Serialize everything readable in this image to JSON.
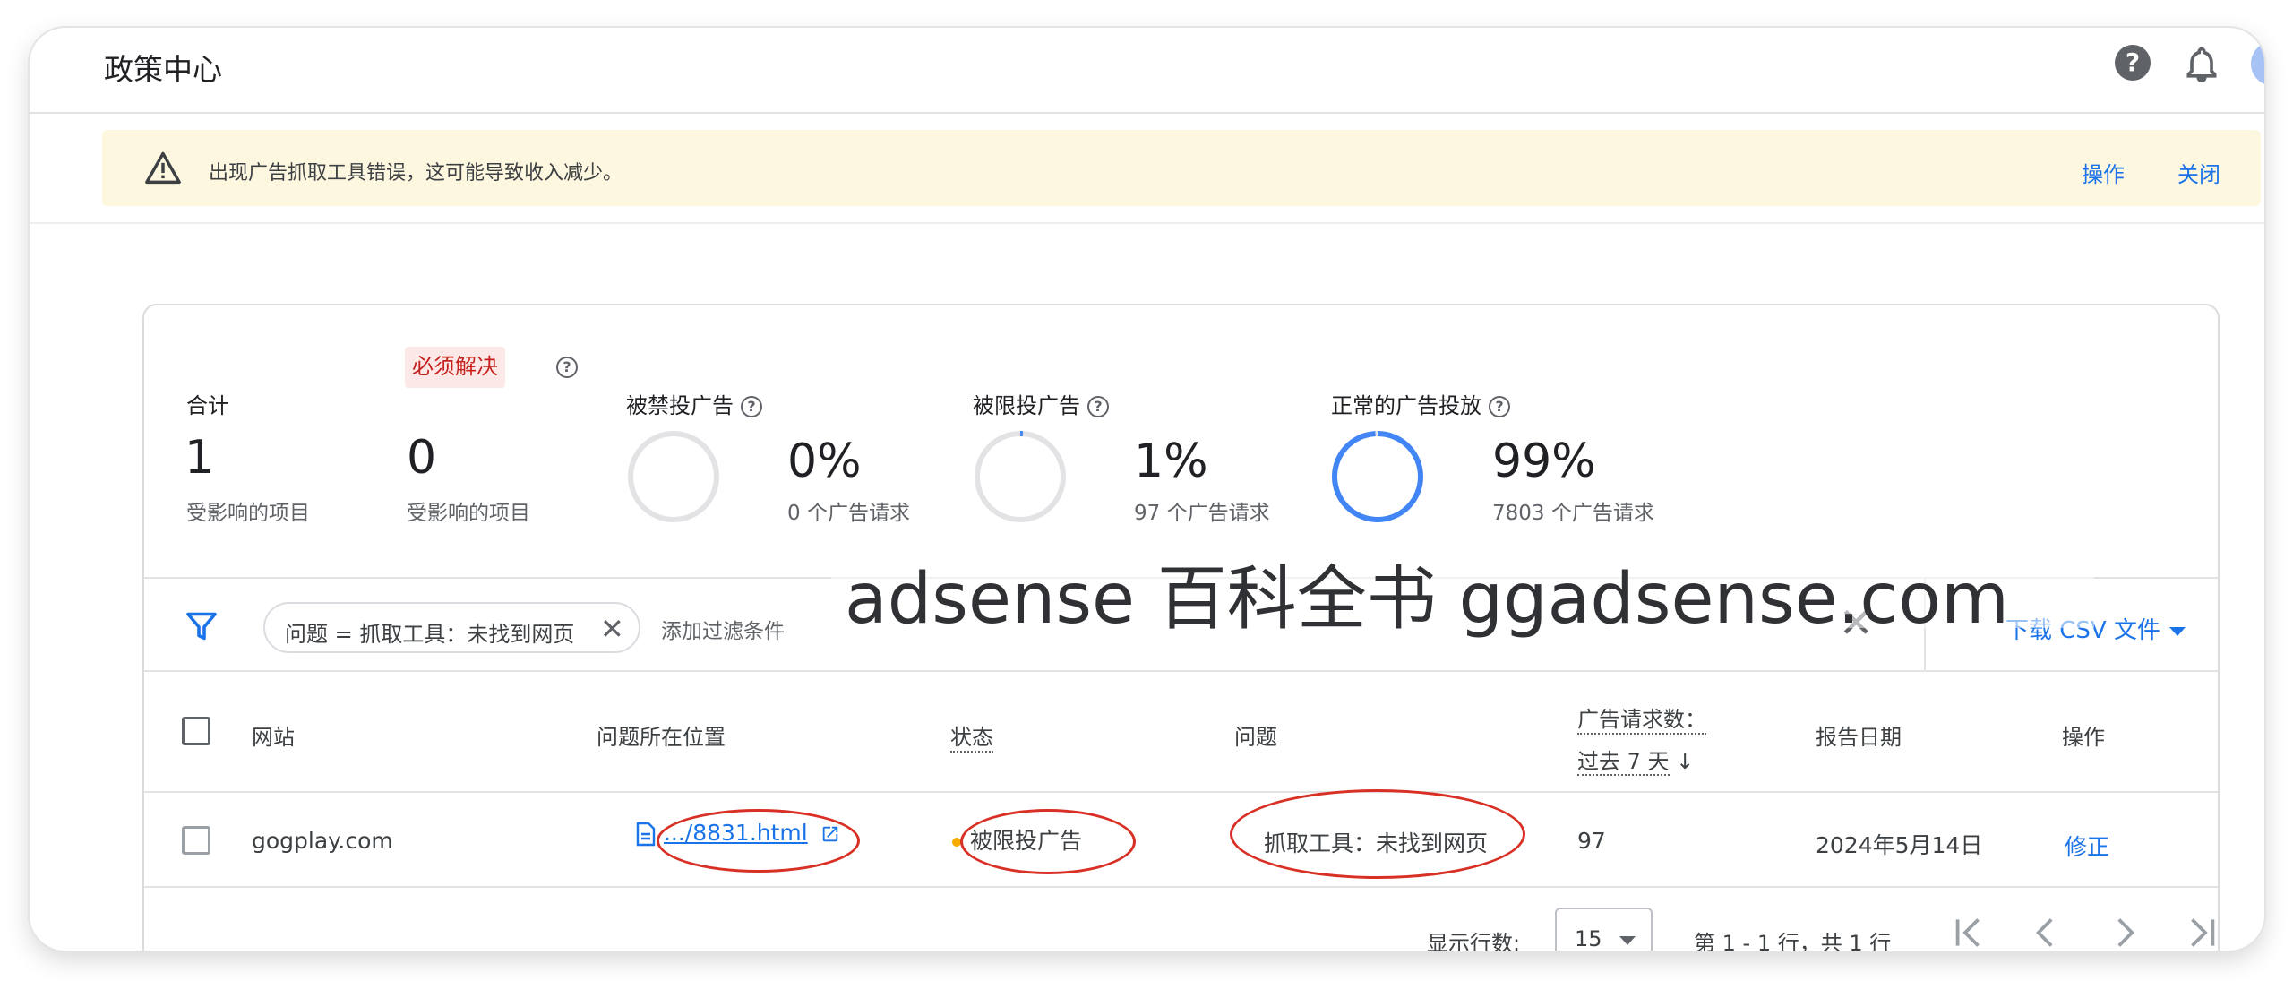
{
  "header": {
    "title": "政策中心",
    "help_icon": "help-circle-icon",
    "notify_icon": "bell-icon"
  },
  "banner": {
    "message": "出现广告抓取工具错误，这可能导致收入减少。",
    "action_label": "操作",
    "close_label": "关闭"
  },
  "stats": {
    "total": {
      "label": "合计",
      "value": "1",
      "sub": "受影响的项目"
    },
    "must_fix": {
      "label": "必须解决",
      "value": "0",
      "sub": "受影响的项目"
    },
    "disabled": {
      "label": "被禁投广告",
      "value": "0%",
      "sub": "0 个广告请求",
      "fraction": 0
    },
    "restricted": {
      "label": "被限投广告",
      "value": "1%",
      "sub": "97 个广告请求",
      "fraction": 0.01
    },
    "normal": {
      "label": "正常的广告投放",
      "value": "99%",
      "sub": "7803 个广告请求",
      "fraction": 0.99,
      "color": "#4285f4"
    }
  },
  "filter": {
    "chip_label": "问题 = 抓取工具：未找到网页",
    "add_placeholder": "添加过滤条件",
    "download_label": "下载 CSV 文件"
  },
  "table": {
    "columns": {
      "site": "网站",
      "location": "问题所在位置",
      "status": "状态",
      "issue": "问题",
      "requests_1": "广告请求数：",
      "requests_2": "过去 7 天",
      "sort_arrow": "↓",
      "date": "报告日期",
      "action": "操作"
    },
    "rows": [
      {
        "site": "gogplay.com",
        "location": ".../8831.html",
        "status": "被限投广告",
        "status_color": "#f9ab00",
        "issue": "抓取工具：未找到网页",
        "requests": "97",
        "date": "2024年5月14日",
        "action": "修正"
      }
    ]
  },
  "pagination": {
    "rows_label": "显示行数:",
    "rows_value": "15",
    "range": "第 1 - 1 行，共 1 行"
  },
  "watermark": "adsense 百科全书 ggadsense.com",
  "accent_color": "#1a73e8"
}
